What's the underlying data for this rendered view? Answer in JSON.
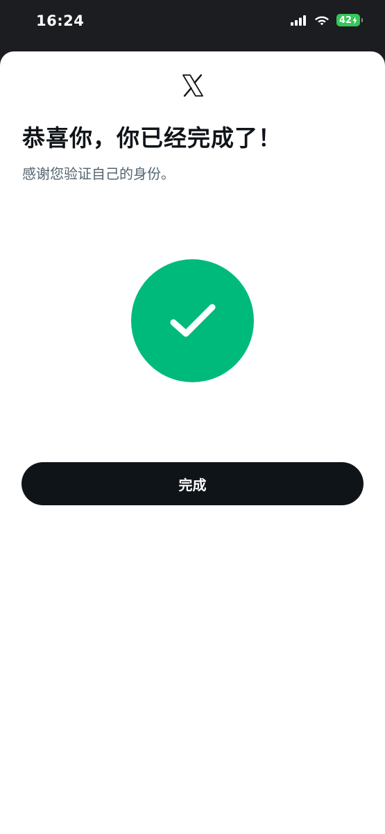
{
  "status_bar": {
    "time": "16:24",
    "battery_level": "42",
    "icons": [
      "signal-icon",
      "wifi-icon",
      "battery-charging-icon"
    ]
  },
  "header": {
    "logo": "x-logo-icon"
  },
  "main": {
    "title": "恭喜你，你已经完成了！",
    "subtitle": "感谢您验证自己的身份。",
    "status_icon": "checkmark-icon",
    "accent_color": "#00ba7c"
  },
  "actions": {
    "done_label": "完成"
  }
}
